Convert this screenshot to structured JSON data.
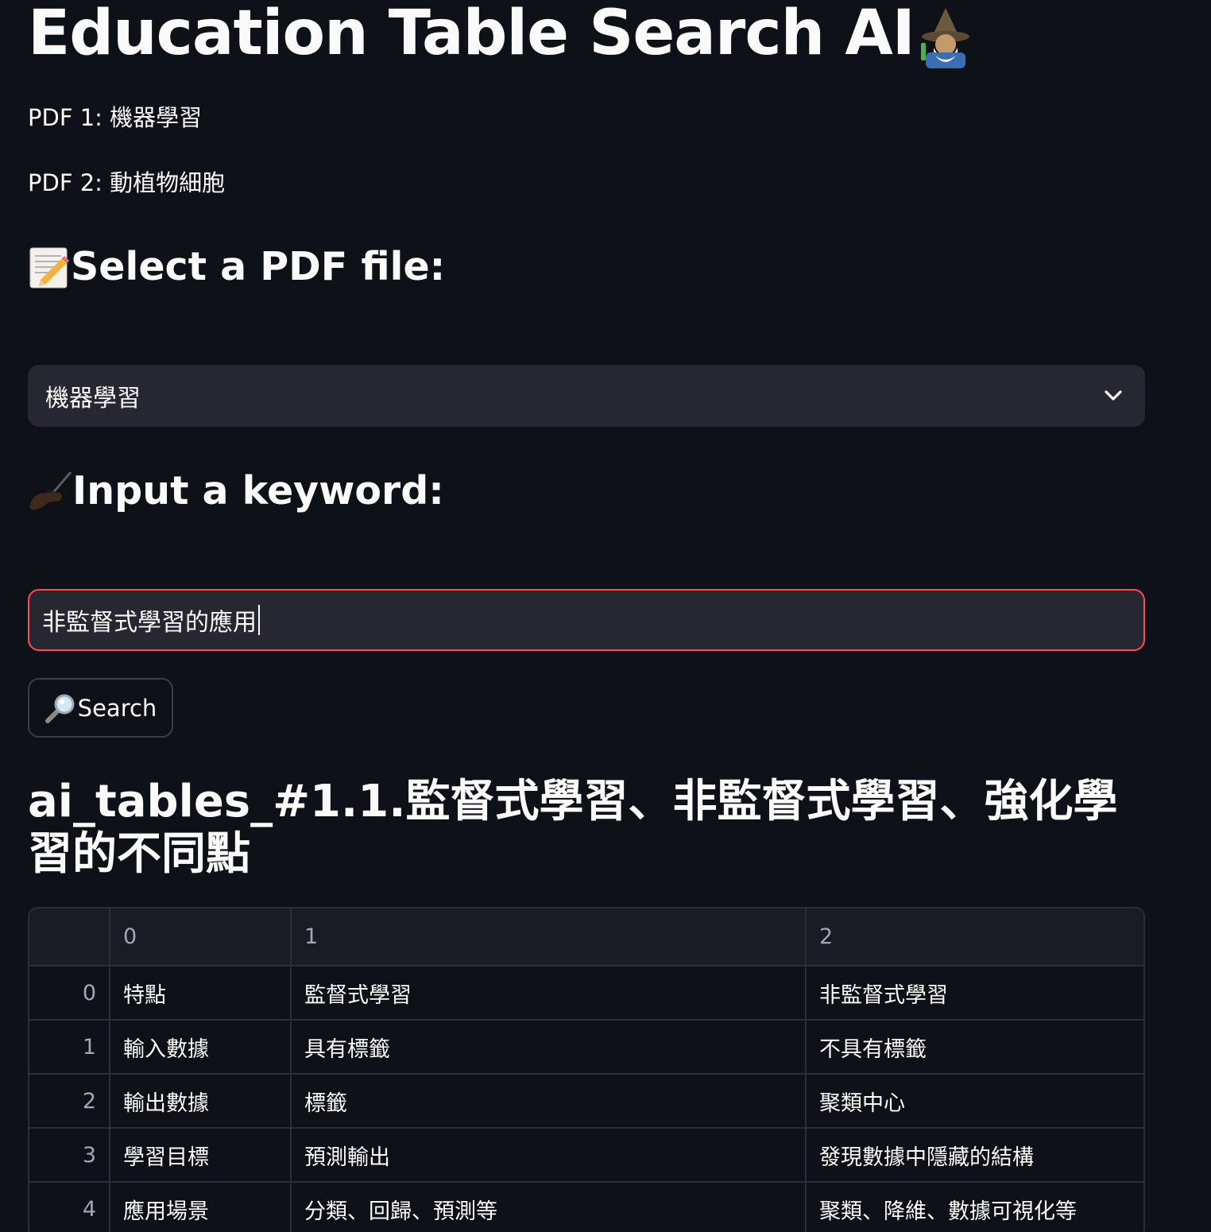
{
  "app": {
    "title": "Education Table Search AI"
  },
  "pdf_list": [
    {
      "label": "PDF 1: 機器學習"
    },
    {
      "label": "PDF 2: 動植物細胞"
    }
  ],
  "select_section": {
    "heading": "Select a PDF file:",
    "icon": "memo-icon",
    "selected_value": "機器學習"
  },
  "keyword_section": {
    "heading": "Input a keyword:",
    "icon": "writing-hand-icon",
    "input_value": "非監督式學習的應用"
  },
  "search_button": {
    "label": "Search",
    "icon": "magnifier-icon"
  },
  "result": {
    "title": "ai_tables_#1.1.監督式學習、非監督式學習、強化學習的不同點",
    "columns": [
      "",
      "0",
      "1",
      "2"
    ],
    "rows": [
      {
        "index": "0",
        "c0": "特點",
        "c1": "監督式學習",
        "c2": "非監督式學習"
      },
      {
        "index": "1",
        "c0": "輸入數據",
        "c1": "具有標籤",
        "c2": "不具有標籤"
      },
      {
        "index": "2",
        "c0": "輸出數據",
        "c1": "標籤",
        "c2": "聚類中心"
      },
      {
        "index": "3",
        "c0": "學習目標",
        "c1": "預測輸出",
        "c2": "發現數據中隱藏的結構"
      },
      {
        "index": "4",
        "c0": "應用場景",
        "c1": "分類、回歸、預測等",
        "c2": "聚類、降維、數據可視化等"
      }
    ]
  },
  "colors": {
    "background": "#0e1117",
    "input_background": "#262730",
    "focus_border": "#ff4b4b",
    "text": "#fafafa"
  }
}
